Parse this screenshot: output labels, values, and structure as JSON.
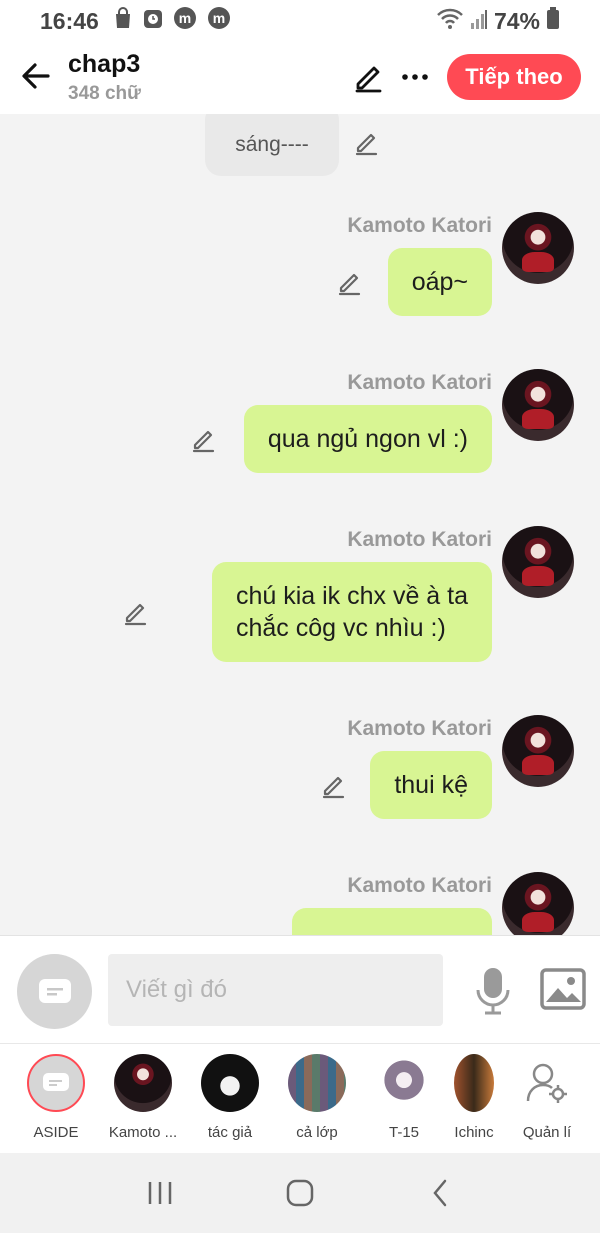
{
  "status_bar": {
    "time": "16:46",
    "battery": "74%"
  },
  "header": {
    "title": "chap3",
    "word_count": "348 chữ",
    "next_label": "Tiếp theo",
    "next_color": "#ff4a54"
  },
  "chat": {
    "narration": {
      "text": "sáng----"
    },
    "messages": [
      {
        "name": "Kamoto Katori",
        "lines": [
          "oáp~"
        ]
      },
      {
        "name": "Kamoto Katori",
        "lines": [
          "qua ngủ ngon vl :)"
        ]
      },
      {
        "name": "Kamoto Katori",
        "lines": [
          "chú kia ik chx về à ta",
          "chắc côg vc nhìu :)"
        ]
      },
      {
        "name": "Kamoto Katori",
        "lines": [
          "thui kệ"
        ]
      },
      {
        "name": "Kamoto Katori",
        "lines": [
          ""
        ]
      }
    ],
    "bubble_color": "#d8f593"
  },
  "composer": {
    "placeholder": "Viết gì đó"
  },
  "characters": [
    {
      "label": "ASIDE"
    },
    {
      "label": "Kamoto ..."
    },
    {
      "label": "tác giả"
    },
    {
      "label": "cả lớp"
    },
    {
      "label": "T-15"
    },
    {
      "label": "Ichinc"
    },
    {
      "label": "Quản lí"
    }
  ]
}
